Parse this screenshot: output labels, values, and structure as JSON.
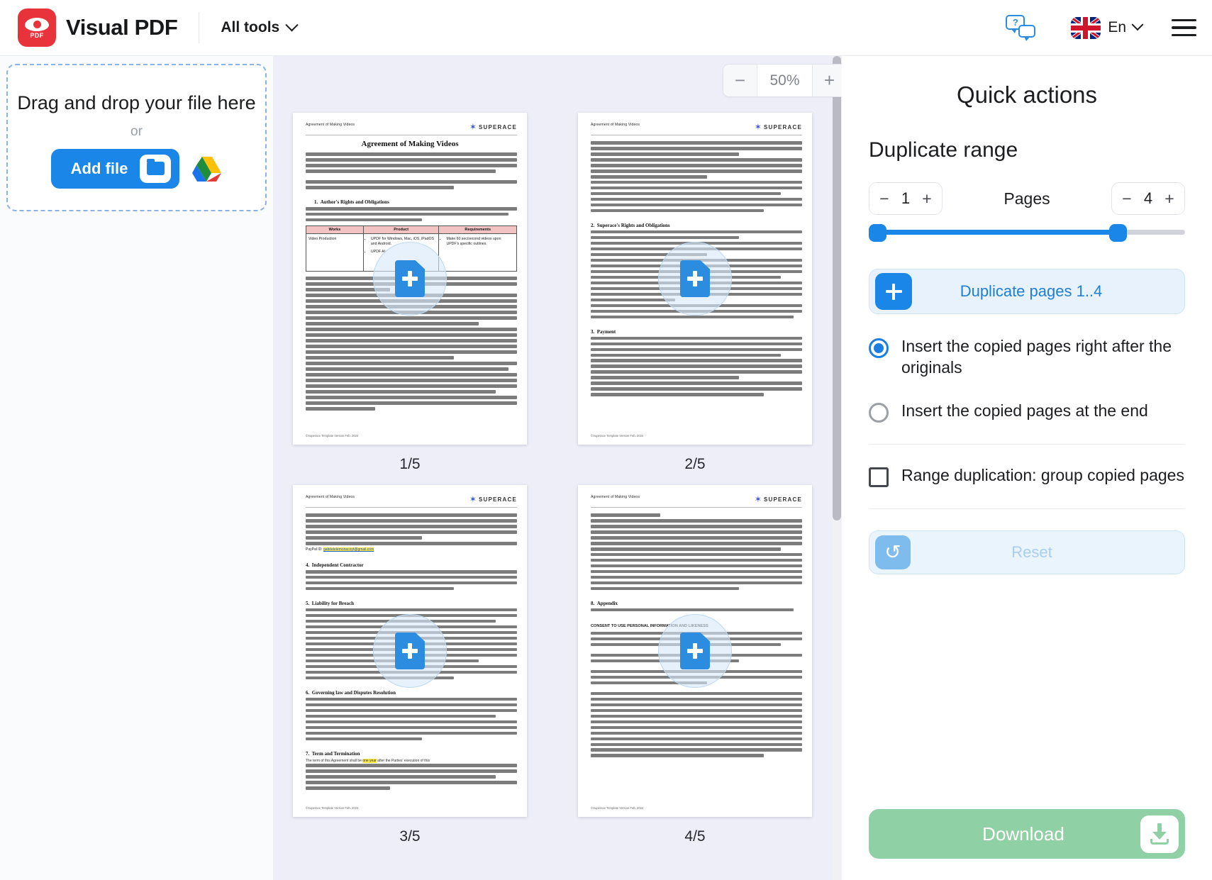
{
  "header": {
    "brand_name": "Visual PDF",
    "logo_badge": "PDF",
    "all_tools_label": "All tools",
    "help_icon": "chat-question-icon",
    "language_label": "En",
    "menu_icon": "hamburger-menu-icon"
  },
  "left_panel": {
    "dropzone_title": "Drag and drop your file here",
    "dropzone_or": "or",
    "add_file_label": "Add file",
    "folder_icon": "folder-icon",
    "gdrive_icon": "google-drive-icon"
  },
  "viewer": {
    "zoom_out_label": "−",
    "zoom_value": "50%",
    "zoom_in_label": "+",
    "pages": [
      {
        "label": "1/5",
        "runhead": "Agreement of Making Videos",
        "brand": "SUPERACE",
        "title": "Agreement of Making Videos",
        "footer": "©Superace Template Version Feb. 2024",
        "table_headers": [
          "Works",
          "Product",
          "Requirements"
        ],
        "table_cell_works": "Video Production",
        "table_cell_product": [
          "UPDF for Windows, Mac, iOS, iPadOS and Android.",
          "UPDF AI"
        ],
        "table_cell_req": "Make 60 sec/second videos upon UPDF's specific outlines."
      },
      {
        "label": "2/5",
        "runhead": "Agreement of Making Videos",
        "brand": "SUPERACE",
        "footer": "©Superace Template Version Feb. 2024"
      },
      {
        "label": "3/5",
        "runhead": "Agreement of Making Videos",
        "brand": "SUPERACE",
        "footer": "©Superace Template Version Feb. 2024",
        "highlight_email": "gabrielelemonacoyt@gmail.com"
      },
      {
        "label": "4/5",
        "runhead": "Agreement of Making Videos",
        "brand": "SUPERACE",
        "footer": "©Superace Template Version Feb. 2024",
        "consent_title": "CONSENT TO USE PERSONAL INFORMATION AND LIKENESS"
      }
    ],
    "add_page_overlay_icon": "document-plus-icon"
  },
  "right_panel": {
    "quick_actions_title": "Quick actions",
    "section_title": "Duplicate range",
    "range_from": "1",
    "range_to": "4",
    "pages_word": "Pages",
    "minus_label": "−",
    "plus_label": "+",
    "duplicate_button_label": "Duplicate pages 1..4",
    "duplicate_button_icon": "plus-icon",
    "options": [
      {
        "label": "Insert the copied pages right after the originals",
        "selected": true
      },
      {
        "label": "Insert the copied pages at the end",
        "selected": false
      }
    ],
    "checkbox_label": "Range duplication: group copied pages",
    "checkbox_checked": false,
    "reset_label": "Reset",
    "reset_icon": "undo-icon",
    "download_label": "Download",
    "download_icon": "download-icon"
  },
  "colors": {
    "brand_red": "#e8333a",
    "accent_blue": "#1a86e8",
    "light_blue_bg": "#e7f2fd",
    "download_green": "#8fd1a4",
    "viewer_bg": "#edeef8"
  }
}
